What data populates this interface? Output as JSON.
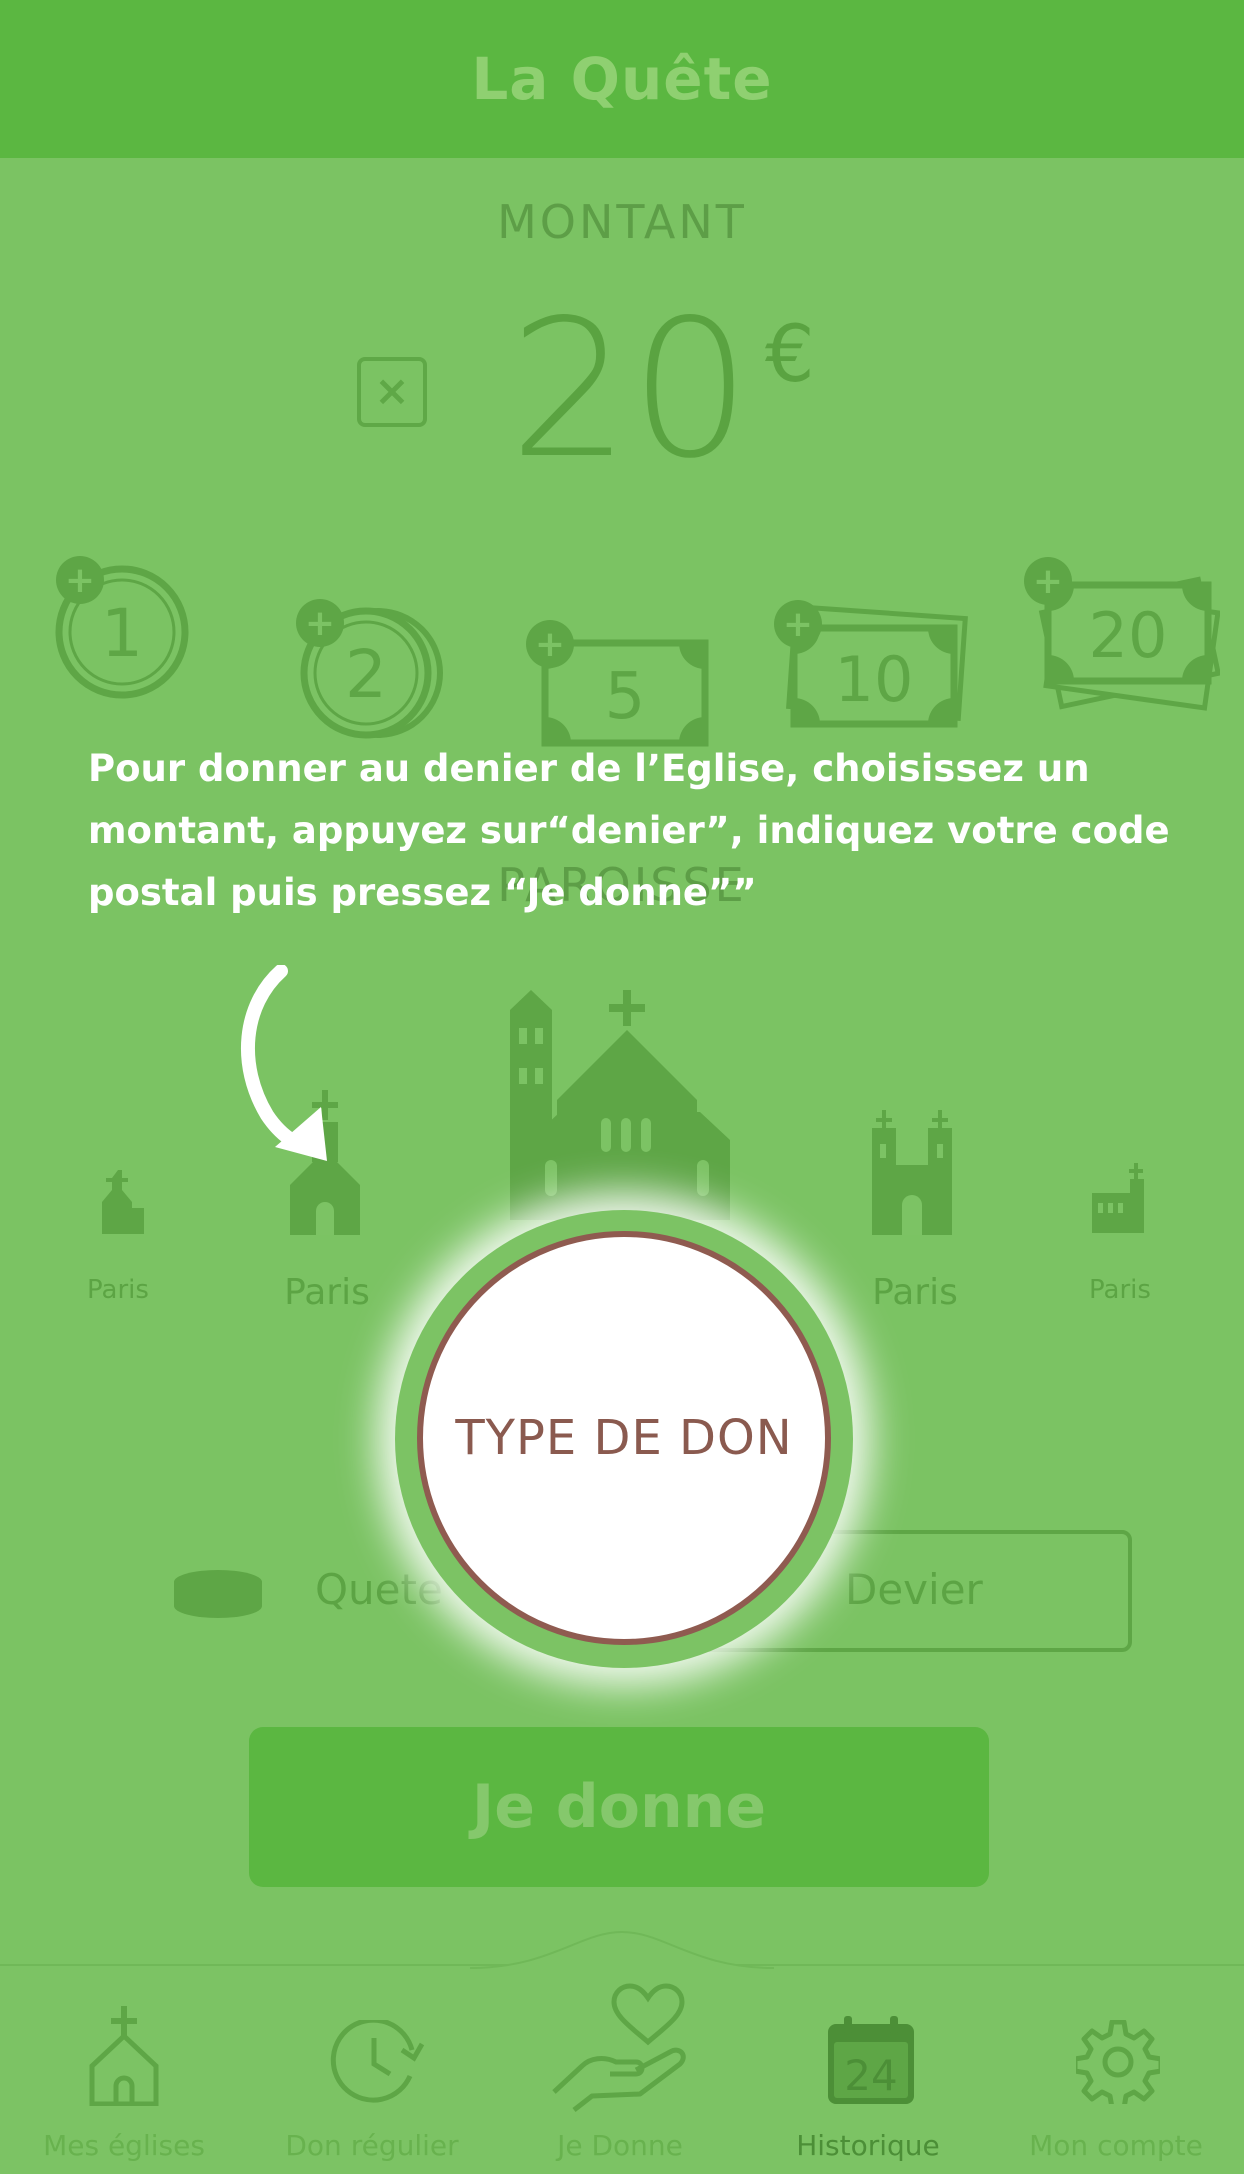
{
  "header": {
    "title": "La Quête"
  },
  "amount": {
    "label": "MONTANT",
    "value": "20",
    "currency": "€",
    "clear_symbol": "×"
  },
  "quick_amounts": [
    {
      "label": "1",
      "kind": "coin"
    },
    {
      "label": "2",
      "kind": "coin"
    },
    {
      "label": "5",
      "kind": "banknote"
    },
    {
      "label": "10",
      "kind": "banknote"
    },
    {
      "label": "20",
      "kind": "banknote-stack"
    }
  ],
  "parish": {
    "label": "PAROISSE",
    "churches": [
      {
        "city": "Paris"
      },
      {
        "city": "Paris"
      },
      {
        "city": "Paris"
      },
      {
        "city": "Paris"
      }
    ]
  },
  "donation_type": {
    "options": [
      {
        "label": "Quete"
      },
      {
        "label": "Devier"
      }
    ]
  },
  "primary_action": {
    "label": "Je donne"
  },
  "tabbar": {
    "tabs": [
      {
        "label": "Mes églises",
        "icon": "church-icon",
        "active": false
      },
      {
        "label": "Don régulier",
        "icon": "clock-refresh-icon",
        "active": false
      },
      {
        "label": "Je Donne",
        "icon": "heart-hand-icon",
        "active": false
      },
      {
        "label": "Historique",
        "icon": "calendar-icon",
        "active": true,
        "badge": "24"
      },
      {
        "label": "Mon compte",
        "icon": "gear-icon",
        "active": false
      }
    ]
  },
  "tutorial": {
    "text": "Pour donner au denier de l’Eglise, choisissez un montant, appuyez sur“denier”, indiquez votre code postal puis pressez “Je donne””",
    "highlight_label": "TYPE DE DON"
  },
  "colors": {
    "header": "#5bb741",
    "background": "#7bc262",
    "accent_dark": "#5aa341",
    "highlight_border": "#8f5b50"
  }
}
